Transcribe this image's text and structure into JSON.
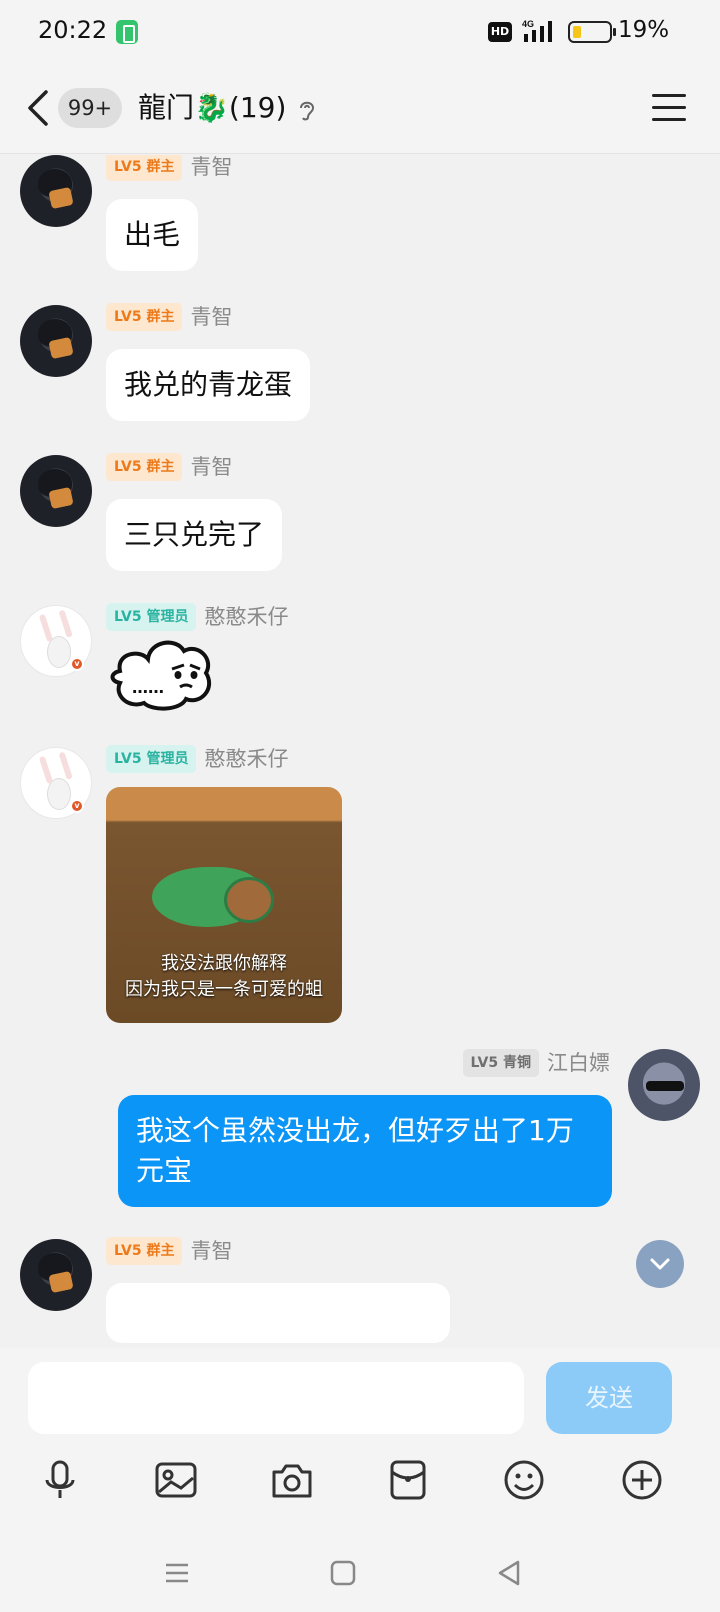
{
  "status_bar": {
    "time": "20:22",
    "hd": "HD",
    "network": "4G",
    "battery": "19%"
  },
  "header": {
    "unread_badge": "99+",
    "group_name": "龍门",
    "dragon_emoji": "🐉",
    "member_count": "(19)"
  },
  "messages": [
    {
      "tag": "LV5 群主",
      "sender": "青智",
      "text": "出毛"
    },
    {
      "tag": "LV5 群主",
      "sender": "青智",
      "text": "我兑的青龙蛋"
    },
    {
      "tag": "LV5 群主",
      "sender": "青智",
      "text": "三只兑完了"
    },
    {
      "tag": "LV5 管理员",
      "sender": "憨憨禾仔",
      "sticker_text": "……"
    },
    {
      "tag": "LV5 管理员",
      "sender": "憨憨禾仔",
      "image_caption_1": "我没法跟你解释",
      "image_caption_2": "因为我只是一条可爱的蛆"
    },
    {
      "tag": "LV5 青铜",
      "sender": "江白嫖",
      "text": "我这个虽然没出龙，但好歹出了1万元宝"
    },
    {
      "tag": "LV5 群主",
      "sender": "青智"
    }
  ],
  "input": {
    "placeholder": "",
    "send_label": "发送"
  },
  "icons": {
    "back": "back-arrow-icon",
    "ear": "ear-icon",
    "menu": "menu-icon",
    "mic": "microphone-icon",
    "image": "image-icon",
    "camera": "camera-icon",
    "redpacket": "red-packet-icon",
    "emoji": "emoji-icon",
    "plus": "plus-icon"
  },
  "colors": {
    "accent": "#0b95f6",
    "owner_tag": "#ed7a1a",
    "admin_tag": "#2bb3a1"
  }
}
